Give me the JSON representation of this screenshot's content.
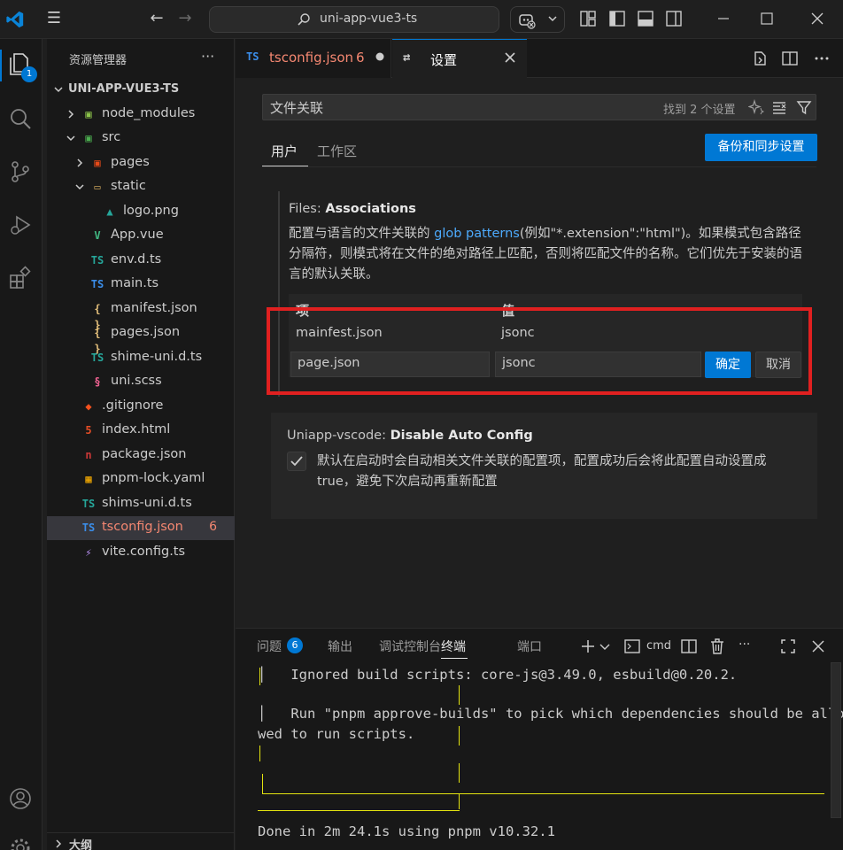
{
  "window": {
    "search_text": "uni-app-vue3-ts",
    "menu_glyph": "☰",
    "back_glyph": "←",
    "forward_glyph": "→"
  },
  "activity": {
    "explorer_badge": "1"
  },
  "sidebar": {
    "title": "资源管理器",
    "more_glyph": "···",
    "tree": [
      {
        "name": "UNI-APP-VUE3-TS",
        "icon": "",
        "icon_color": "#cccccc",
        "kind": "root"
      },
      {
        "name": "node_modules",
        "icon": "▣",
        "icon_color": "#8bc34a",
        "kind": "folder-closed"
      },
      {
        "name": "src",
        "icon": "▣",
        "icon_color": "#4caf50",
        "kind": "folder-open"
      },
      {
        "name": "pages",
        "icon": "▣",
        "icon_color": "#e64a19",
        "kind": "folder-closed"
      },
      {
        "name": "static",
        "icon": "▭",
        "icon_color": "#c7a05a",
        "kind": "folder-open"
      },
      {
        "name": "logo.png",
        "icon": "▲",
        "icon_color": "#26a69a",
        "kind": "file"
      },
      {
        "name": "App.vue",
        "icon": "V",
        "icon_color": "#41b883",
        "kind": "file"
      },
      {
        "name": "env.d.ts",
        "icon": "TS",
        "icon_color": "#26a69a",
        "kind": "file"
      },
      {
        "name": "main.ts",
        "icon": "TS",
        "icon_color": "#3b8eea",
        "kind": "file"
      },
      {
        "name": "manifest.json",
        "icon": "{ }",
        "icon_color": "#e5c07b",
        "kind": "file"
      },
      {
        "name": "pages.json",
        "icon": "{ }",
        "icon_color": "#e5c07b",
        "kind": "file"
      },
      {
        "name": "shime-uni.d.ts",
        "icon": "TS",
        "icon_color": "#26a69a",
        "kind": "file"
      },
      {
        "name": "uni.scss",
        "icon": "§",
        "icon_color": "#f06292",
        "kind": "file"
      },
      {
        "name": ".gitignore",
        "icon": "◆",
        "icon_color": "#f4511e",
        "kind": "file"
      },
      {
        "name": "index.html",
        "icon": "5",
        "icon_color": "#e44d26",
        "kind": "file"
      },
      {
        "name": "package.json",
        "icon": "n",
        "icon_color": "#cb3837",
        "kind": "file"
      },
      {
        "name": "pnpm-lock.yaml",
        "icon": "▦",
        "icon_color": "#f9ad00",
        "kind": "file"
      },
      {
        "name": "shims-uni.d.ts",
        "icon": "TS",
        "icon_color": "#26a69a",
        "kind": "file"
      },
      {
        "name": "tsconfig.json",
        "icon": "TS",
        "icon_color": "#3b8eea",
        "kind": "file",
        "selected": true,
        "errors": "6"
      },
      {
        "name": "vite.config.ts",
        "icon": "⚡",
        "icon_color": "#bd93f9",
        "kind": "file"
      }
    ],
    "outline_label": "大纲"
  },
  "tabs": [
    {
      "icon": "TS",
      "label": "tsconfig.json",
      "count": "6",
      "label_color": "#f48771"
    },
    {
      "icon": "⇄",
      "label": "设置",
      "label_color": "#ffffff"
    }
  ],
  "settings": {
    "search_query": "文件关联",
    "found_text": "找到 2 个设置",
    "scope_tabs": [
      "用户",
      "工作区"
    ],
    "sync_button": "备份和同步设置",
    "assoc": {
      "category": "Files: ",
      "name": "Associations",
      "desc_before": "配置与语言的文件关联的 ",
      "desc_link": "glob patterns",
      "desc_after": "(例如\"*.extension\":\"html\")。如果模式包含路径分隔符，则模式将在文件的绝对路径上匹配，否则将匹配文件的名称。它们优先于安装的语言的默认关联。",
      "header_key": "项",
      "header_value": "值",
      "row_key": "mainfest.json",
      "row_value": "jsonc",
      "edit_key": "page.json",
      "edit_value": "jsonc",
      "ok_button": "确定",
      "cancel_button": "取消"
    },
    "uniapp": {
      "category": "Uniapp-vscode: ",
      "name": "Disable Auto Config",
      "checked": true,
      "desc": "默认在启动时会自动相关文件关联的配置项，配置成功后会将此配置自动设置成 true，避免下次启动再重新配置"
    }
  },
  "panel": {
    "tabs": [
      "问题",
      "输出",
      "调试控制台",
      "终端",
      "端口"
    ],
    "problems_badge": "6",
    "shell_label": "cmd",
    "more_glyph": "···",
    "terminal_lines": [
      "│   Ignored build scripts: core-js@3.49.0, esbuild@0.20.2.",
      "│   Run \"pnpm approve-builds\" to pick which dependencies should be allo",
      "wed to run scripts.",
      "Done in 2m 24.1s using pnpm v10.32.1"
    ]
  }
}
